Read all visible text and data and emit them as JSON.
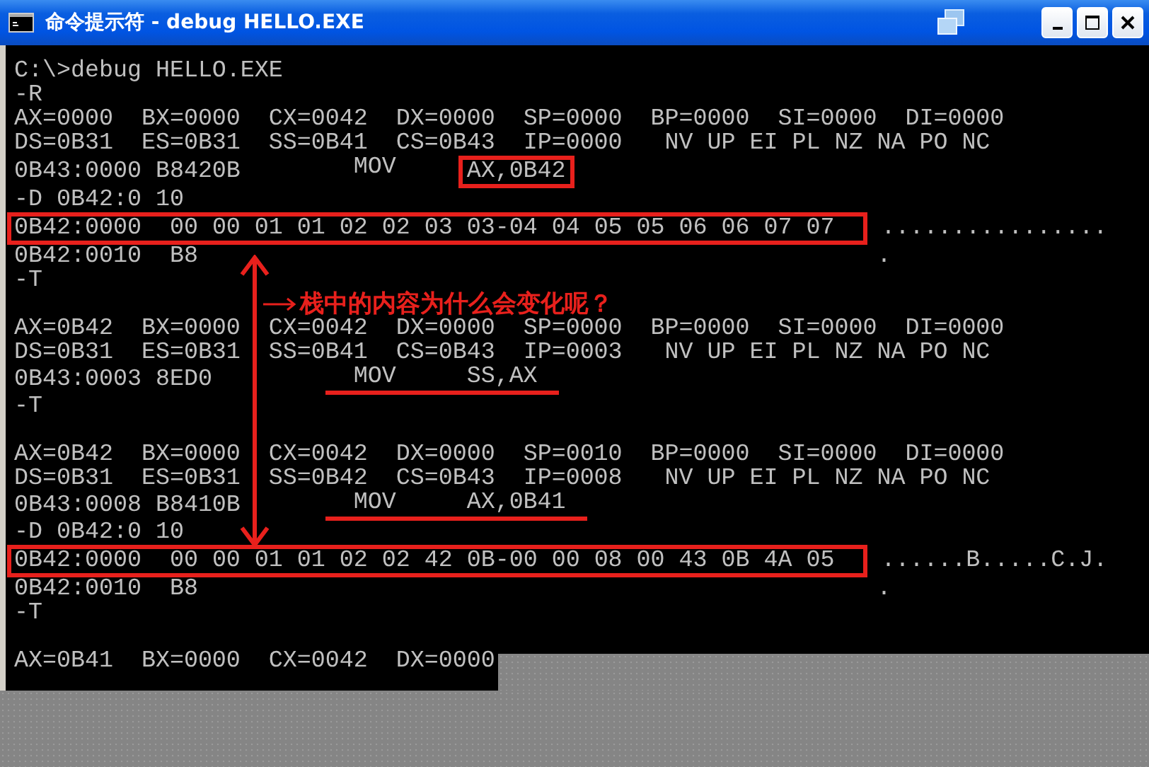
{
  "window": {
    "title": "命令提示符 - debug HELLO.EXE"
  },
  "console": {
    "blocks": [
      [
        {
          "kind": "text",
          "text": "C:\\>debug HELLO.EXE"
        },
        {
          "kind": "text",
          "text": "-R"
        },
        {
          "kind": "text",
          "text": "AX=0000  BX=0000  CX=0042  DX=0000  SP=0000  BP=0000  SI=0000  DI=0000"
        },
        {
          "kind": "text",
          "text": "DS=0B31  ES=0B31  SS=0B41  CS=0B43  IP=0000   NV UP EI PL NZ NA PO NC"
        },
        {
          "kind": "instruction",
          "address": "0B43:0000",
          "code": "B8420B",
          "mnemonic": "MOV",
          "operand": "AX,0B42",
          "boxed": true,
          "underlined": false
        },
        {
          "kind": "text",
          "text": "-D 0B42:0 10"
        },
        {
          "kind": "dump",
          "address": "0B42:0000",
          "bytes": "00 00 01 01 02 02 03 03-04 04 05 05 06 06 07 07",
          "ascii": "................",
          "boxed": true
        },
        {
          "kind": "dump",
          "address": "0B42:0010",
          "bytes": "B8",
          "ascii": ".",
          "boxed": false
        },
        {
          "kind": "text",
          "text": "-T"
        }
      ],
      [
        {
          "kind": "text",
          "text": "AX=0B42  BX=0000  CX=0042  DX=0000  SP=0000  BP=0000  SI=0000  DI=0000"
        },
        {
          "kind": "text",
          "text": "DS=0B31  ES=0B31  SS=0B41  CS=0B43  IP=0003   NV UP EI PL NZ NA PO NC"
        },
        {
          "kind": "instruction",
          "address": "0B43:0003",
          "code": "8ED0",
          "mnemonic": "MOV",
          "operand": "SS,AX",
          "boxed": false,
          "underlined": true
        },
        {
          "kind": "text",
          "text": "-T"
        }
      ],
      [
        {
          "kind": "text",
          "text": "AX=0B42  BX=0000  CX=0042  DX=0000  SP=0010  BP=0000  SI=0000  DI=0000"
        },
        {
          "kind": "text",
          "text": "DS=0B31  ES=0B31  SS=0B42  CS=0B43  IP=0008   NV UP EI PL NZ NA PO NC"
        },
        {
          "kind": "instruction",
          "address": "0B43:0008",
          "code": "B8410B",
          "mnemonic": "MOV",
          "operand": "AX,0B41",
          "boxed": false,
          "underlined": true
        },
        {
          "kind": "text",
          "text": "-D 0B42:0 10"
        },
        {
          "kind": "dump",
          "address": "0B42:0000",
          "bytes": "00 00 01 01 02 02 42 0B-00 00 08 00 43 0B 4A 05",
          "ascii": "......B.....C.J.",
          "boxed": true
        },
        {
          "kind": "dump",
          "address": "0B42:0010",
          "bytes": "B8",
          "ascii": ".",
          "boxed": false
        },
        {
          "kind": "text",
          "text": "-T"
        }
      ],
      [
        {
          "kind": "text",
          "text": "AX=0B41  BX=0000  CX=0042  DX=0000"
        }
      ]
    ]
  },
  "annotation": {
    "note": "栈中的内容为什么会变化呢？"
  }
}
